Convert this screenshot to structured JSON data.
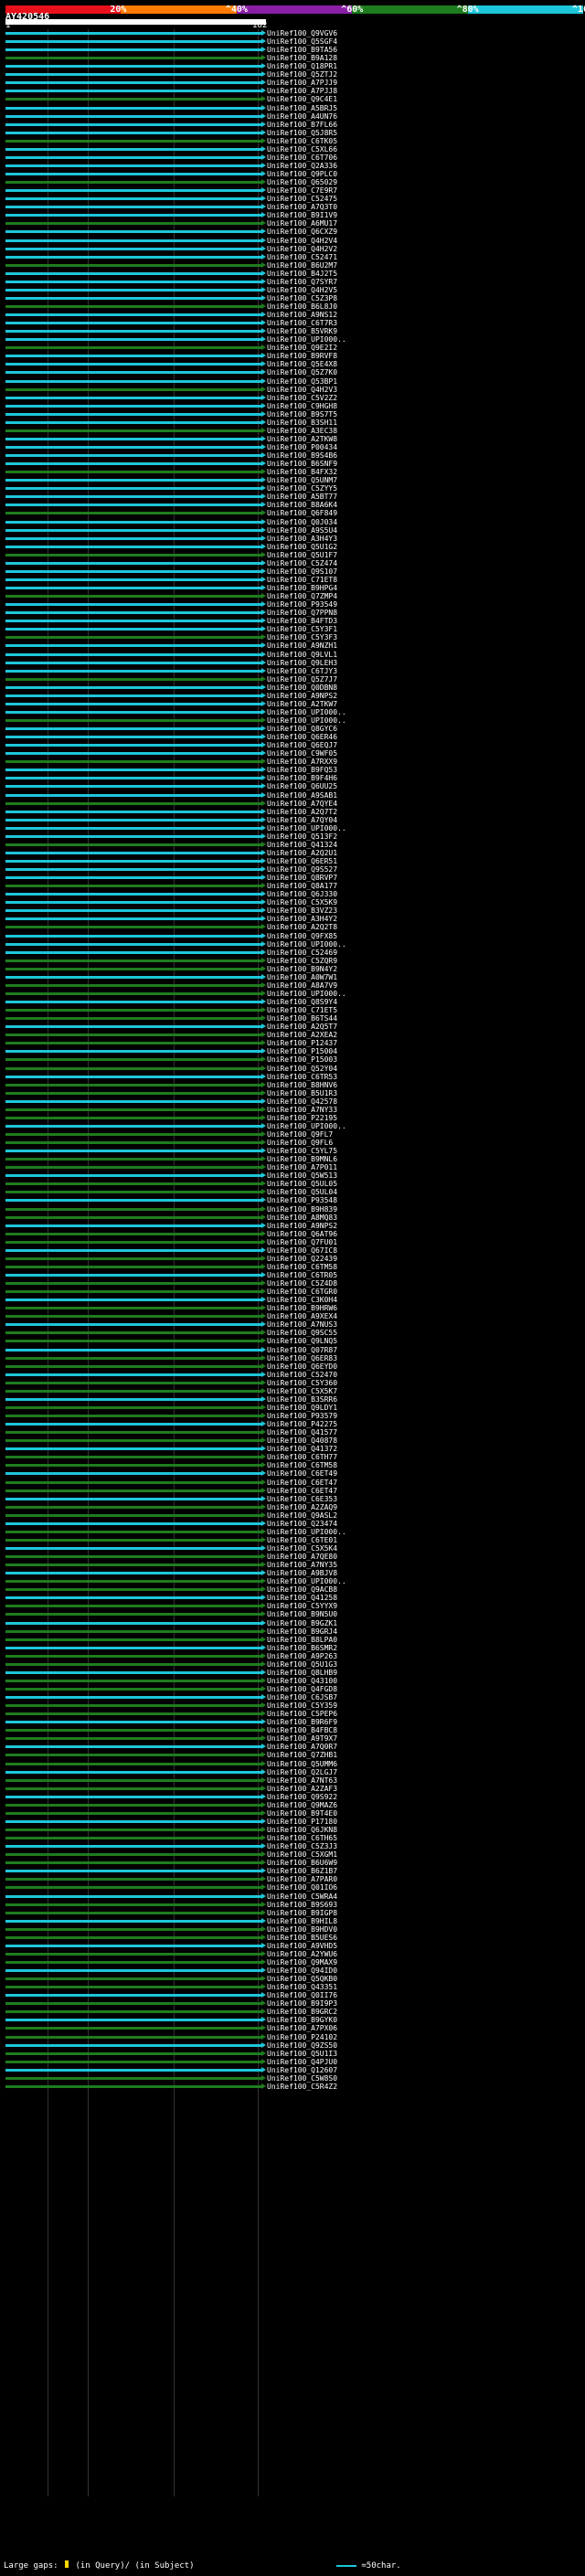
{
  "legend": {
    "ticks": [
      "20%",
      "^40%",
      "^60%",
      "^80%",
      "^100%"
    ],
    "colors": [
      "#e8101a",
      "#ff7a00",
      "#8a1fa6",
      "#1e7d1e",
      "#1ec6d9"
    ]
  },
  "query": {
    "id": "AY420546",
    "start": "1",
    "end": "162"
  },
  "footer": {
    "gaps_label": "Large gaps:",
    "query_label": "(in Query)/",
    "subject_label": "(in Subject)",
    "scale_label": "=50char."
  },
  "hits": [
    "UniRef100_Q9VGV6",
    "UniRef100_Q5SGF4",
    "UniRef100_B9TA56",
    "UniRef100_B9A128",
    "UniRef100_Q18PR1",
    "UniRef100_Q5ZTJ2",
    "UniRef100_A7PJJ9",
    "UniRef100_A7PJJ8",
    "UniRef100_Q9C4E1",
    "UniRef100_A5BRJ5",
    "UniRef100_A4UN76",
    "UniRef100_B7FL66",
    "UniRef100_Q5J8R5",
    "UniRef100_C6TK05",
    "UniRef100_C5XL66",
    "UniRef100_C6T706",
    "UniRef100_Q2A336",
    "UniRef100_Q9PLC0",
    "UniRef100_Q65029",
    "UniRef100_C7E9R7",
    "UniRef100_C52475",
    "UniRef100_A7Q3T0",
    "UniRef100_B9I1V9",
    "UniRef100_A6MU17",
    "UniRef100_Q6CXZ9",
    "UniRef100_Q4H2V4",
    "UniRef100_Q4H2V2",
    "UniRef100_C52471",
    "UniRef100_B6U2M7",
    "UniRef100_B4J2T5",
    "UniRef100_Q7SYR7",
    "UniRef100_Q4H2V5",
    "UniRef100_C5Z3P8",
    "UniRef100_B6L8J0",
    "UniRef100_A9NS12",
    "UniRef100_C6T7R3",
    "UniRef100_B5VRK9",
    "UniRef100_UPI000..",
    "UniRef100_Q9E2I2",
    "UniRef100_B9RVF8",
    "UniRef100_Q5E4X8",
    "UniRef100_Q5Z7K0",
    "UniRef100_Q53BP1",
    "UniRef100_Q4H2V3",
    "UniRef100_C5V2Z2",
    "UniRef100_C9HGH8",
    "UniRef100_B9S7T5",
    "UniRef100_B3SH11",
    "UniRef100_A3EC38",
    "UniRef100_A2TKW8",
    "UniRef100_P00434",
    "UniRef100_B9S4B6",
    "UniRef100_B6SNF9",
    "UniRef100_B4FX32",
    "UniRef100_Q5UNM7",
    "UniRef100_C5ZYY5",
    "UniRef100_A5BT77",
    "UniRef100_B8A6K4",
    "UniRef100_Q6F849",
    "UniRef100_Q0J034",
    "UniRef100_A9S5U4",
    "UniRef100_A3H4Y3",
    "UniRef100_Q5U1G2",
    "UniRef100_Q5U1F7",
    "UniRef100_C5Z474",
    "UniRef100_Q9S107",
    "UniRef100_C71ET8",
    "UniRef100_B9HPG4",
    "UniRef100_Q7ZMP4",
    "UniRef100_P93549",
    "UniRef100_Q7PPN8",
    "UniRef100_B4FTD3",
    "UniRef100_C5Y3F1",
    "UniRef100_C5Y3F3",
    "UniRef100_A9NZH1",
    "UniRef100_Q9LVL1",
    "UniRef100_Q9LEH3",
    "UniRef100_C6TJY3",
    "UniRef100_Q5Z7J7",
    "UniRef100_Q0DBN8",
    "UniRef100_A9NPS2",
    "UniRef100_A2TKW7",
    "UniRef100_UPI000..",
    "UniRef100_UPI000..",
    "UniRef100_Q8GYC6",
    "UniRef100_Q6ER46",
    "UniRef100_Q6EQJ7",
    "UniRef100_C9WF05",
    "UniRef100_A7RXX9",
    "UniRef100_B9FQ53",
    "UniRef100_B9F4H6",
    "UniRef100_Q6UU25",
    "UniRef100_A9SAB1",
    "UniRef100_A7QYE4",
    "UniRef100_A2Q7T2",
    "UniRef100_A7QY04",
    "UniRef100_UPI000..",
    "UniRef100_Q513F2",
    "UniRef100_Q41324",
    "UniRef100_A2Q2U1",
    "UniRef100_Q6ER51",
    "UniRef100_Q9S527",
    "UniRef100_Q8RVP7",
    "UniRef100_Q8A177",
    "UniRef100_Q6J330",
    "UniRef100_C5X5K9",
    "UniRef100_B3VZ23",
    "UniRef100_A3H4Y2",
    "UniRef100_A2Q2T8",
    "UniRef100_Q9FX85",
    "UniRef100_UPI000..",
    "UniRef100_C52469",
    "UniRef100_C5ZQR9",
    "UniRef100_B9N4Y2",
    "UniRef100_A0W7W1",
    "UniRef100_A8A7V9",
    "UniRef100_UPI000..",
    "UniRef100_Q8S9Y4",
    "UniRef100_C71ET5",
    "UniRef100_B6TS44",
    "UniRef100_A2Q5T7",
    "UniRef100_A2XEA2",
    "UniRef100_P12437",
    "UniRef100_P15004",
    "UniRef100_P15003",
    "UniRef100_Q52Y04",
    "UniRef100_C6TR53",
    "UniRef100_B8HNV6",
    "UniRef100_B5U1R3",
    "UniRef100_Q42578",
    "UniRef100_A7NY33",
    "UniRef100_P22195",
    "UniRef100_UPI000..",
    "UniRef100_Q9FL7",
    "UniRef100_Q9FL6",
    "UniRef100_C5YL75",
    "UniRef100_B9MNL6",
    "UniRef100_A7P011",
    "UniRef100_Q5W513",
    "UniRef100_Q5UL05",
    "UniRef100_Q5UL04",
    "UniRef100_P93548",
    "UniRef100_B9H839",
    "UniRef100_A8MQ83",
    "UniRef100_A9NPS2",
    "UniRef100_Q6AT96",
    "UniRef100_Q7FU01",
    "UniRef100_Q67IC8",
    "UniRef100_Q22439",
    "UniRef100_C6TM58",
    "UniRef100_C6TR05",
    "UniRef100_C5Z4D8",
    "UniRef100_C6TGR0",
    "UniRef100_C3K0H4",
    "UniRef100_B9HRW6",
    "UniRef100_A9XEX4",
    "UniRef100_A7NUS3",
    "UniRef100_Q9SC55",
    "UniRef100_Q9LNQ5",
    "UniRef100_Q07R87",
    "UniRef100_Q6ER83",
    "UniRef100_Q6EYD0",
    "UniRef100_C52470",
    "UniRef100_C5Y360",
    "UniRef100_C5X5K7",
    "UniRef100_B3SRR6",
    "UniRef100_Q9LDY1",
    "UniRef100_P93579",
    "UniRef100_P42275",
    "UniRef100_Q41577",
    "UniRef100_Q40878",
    "UniRef100_Q41372",
    "UniRef100_C6TH77",
    "UniRef100_C6TM58",
    "UniRef100_C6ET49",
    "UniRef100_C6ET47",
    "UniRef100_C6ET47",
    "UniRef100_C6E353",
    "UniRef100_A2ZAQ9",
    "UniRef100_Q9ASL2",
    "UniRef100_Q23474",
    "UniRef100_UPI000..",
    "UniRef100_C6TE01",
    "UniRef100_C5X5K4",
    "UniRef100_A7QE80",
    "UniRef100_A7NY35",
    "UniRef100_A9BJV8",
    "UniRef100_UPI000..",
    "UniRef100_Q9ACB8",
    "UniRef100_Q41258",
    "UniRef100_C5YYX9",
    "UniRef100_B9N5U0",
    "UniRef100_B9GZK1",
    "UniRef100_B9GRJ4",
    "UniRef100_B8LPA0",
    "UniRef100_B6SMR2",
    "UniRef100_A9P263",
    "UniRef100_Q5U1G3",
    "UniRef100_Q8LHB9",
    "UniRef100_Q43100",
    "UniRef100_Q4FGD8",
    "UniRef100_C6JSB7",
    "UniRef100_C5Y359",
    "UniRef100_C5PEP6",
    "UniRef100_B9R6F9",
    "UniRef100_B4FBC8",
    "UniRef100_A9T9X7",
    "UniRef100_A7Q0R7",
    "UniRef100_Q7ZHB1",
    "UniRef100_Q5UMM6",
    "UniRef100_Q2LGJ7",
    "UniRef100_A7NT63",
    "UniRef100_A2ZAF3",
    "UniRef100_Q9S922",
    "UniRef100_Q9MAZ6",
    "UniRef100_B9T4E0",
    "UniRef100_P17180",
    "UniRef100_Q6JKN8",
    "UniRef100_C6TH65",
    "UniRef100_C5Z3J3",
    "UniRef100_C5XGM1",
    "UniRef100_B6U6W9",
    "UniRef100_B6Z1B7",
    "UniRef100_A7PAR0",
    "UniRef100_Q01IO6",
    "UniRef100_C5WRA4",
    "UniRef100_B9S693",
    "UniRef100_B9IGP8",
    "UniRef100_B9HIL8",
    "UniRef100_B9HDV0",
    "UniRef100_B5UES6",
    "UniRef100_A9VHD5",
    "UniRef100_A2YWU6",
    "UniRef100_Q9MAX9",
    "UniRef100_Q94ID0",
    "UniRef100_Q5QKB0",
    "UniRef100_Q43351",
    "UniRef100_Q0II76",
    "UniRef100_B9I9P3",
    "UniRef100_B9GRC2",
    "UniRef100_B9GYK0",
    "UniRef100_A7PX06",
    "UniRef100_P24102",
    "UniRef100_Q9ZS50",
    "UniRef100_Q5U1I3",
    "UniRef100_Q4PJU0",
    "UniRef100_Q12607",
    "UniRef100_C5W8S0",
    "UniRef100_C5R4Z2"
  ]
}
